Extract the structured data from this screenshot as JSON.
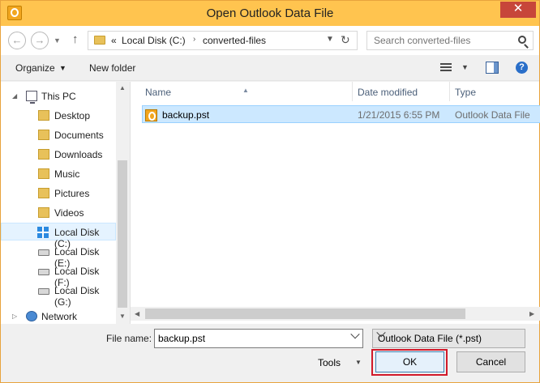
{
  "window": {
    "title": "Open Outlook Data File",
    "close_glyph": "✕",
    "accent_color": "#ffc44f"
  },
  "navbar": {
    "back_glyph": "←",
    "forward_glyph": "→",
    "up_glyph": "↑",
    "refresh_glyph": "↻",
    "breadcrumb": {
      "overflow": "«",
      "items": [
        "Local Disk (C:)",
        "converted-files"
      ],
      "separator": "›"
    },
    "search_placeholder": "Search converted-files"
  },
  "toolbar": {
    "organize_label": "Organize",
    "new_folder_label": "New folder",
    "help_glyph": "?"
  },
  "navpane": {
    "root": {
      "label": "This PC",
      "icon": "computer-icon"
    },
    "items": [
      {
        "label": "Desktop",
        "icon": "folder-icon"
      },
      {
        "label": "Documents",
        "icon": "folder-icon"
      },
      {
        "label": "Downloads",
        "icon": "folder-icon"
      },
      {
        "label": "Music",
        "icon": "folder-icon"
      },
      {
        "label": "Pictures",
        "icon": "folder-icon"
      },
      {
        "label": "Videos",
        "icon": "folder-icon"
      },
      {
        "label": "Local Disk (C:)",
        "icon": "windows-drive-icon",
        "selected": true
      },
      {
        "label": "Local Disk (E:)",
        "icon": "drive-icon"
      },
      {
        "label": "Local Disk (F:)",
        "icon": "drive-icon"
      },
      {
        "label": "Local Disk (G:)",
        "icon": "drive-icon"
      }
    ],
    "network": {
      "label": "Network",
      "icon": "network-icon"
    }
  },
  "filelist": {
    "columns": [
      "Name",
      "Date modified",
      "Type"
    ],
    "rows": [
      {
        "name": "backup.pst",
        "date_modified": "1/21/2015 6:55 PM",
        "type": "Outlook Data File",
        "selected": true
      }
    ]
  },
  "footer": {
    "file_name_label": "File name:",
    "file_name_value": "backup.pst",
    "file_type_value": "Outlook Data File (*.pst)",
    "tools_label": "Tools",
    "ok_label": "OK",
    "cancel_label": "Cancel"
  }
}
